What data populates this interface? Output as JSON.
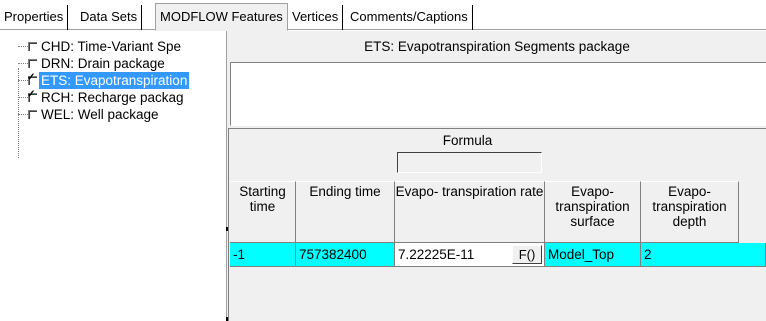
{
  "tabs": [
    {
      "label": "Properties",
      "active": false
    },
    {
      "label": "Data Sets",
      "active": false
    },
    {
      "label": "MODFLOW Features",
      "active": true
    },
    {
      "label": "Vertices",
      "active": false
    },
    {
      "label": "Comments/Captions",
      "active": false
    }
  ],
  "tree": {
    "items": [
      {
        "label": "CHD: Time-Variant Spe",
        "checked": false,
        "selected": false
      },
      {
        "label": "DRN: Drain package",
        "checked": false,
        "selected": false
      },
      {
        "label": "ETS: Evapotranspiration",
        "checked": true,
        "selected": true
      },
      {
        "label": "RCH: Recharge packag",
        "checked": true,
        "selected": false
      },
      {
        "label": "WEL: Well package",
        "checked": false,
        "selected": false
      }
    ]
  },
  "panel": {
    "title": "ETS: Evapotranspiration Segments package",
    "formula_label": "Formula",
    "formula_value": ""
  },
  "grid": {
    "columns": [
      {
        "label": "Starting time"
      },
      {
        "label": "Ending time"
      },
      {
        "label": "Evapo- transpiration rate"
      },
      {
        "label": "Evapo- transpiration surface"
      },
      {
        "label": "Evapo- transpiration depth"
      }
    ],
    "rows": [
      {
        "start": "-1",
        "end": "757382400",
        "rate": "7.22225E-11",
        "surface": "Model_Top",
        "depth": "2"
      }
    ],
    "formula_button_label": "F()"
  },
  "colors": {
    "selection": "#3399ff",
    "row_highlight": "#00ffff",
    "panel_bg": "#f0f0f0"
  }
}
